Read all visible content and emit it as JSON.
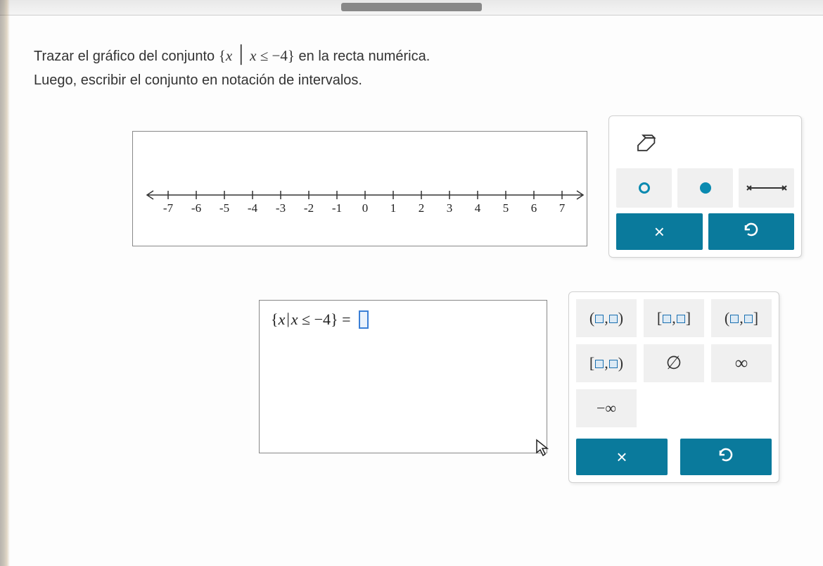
{
  "problem": {
    "line1_pre": "Trazar el gráfico del conjunto ",
    "set_open": "{",
    "set_var": "x",
    "set_bar": "│",
    "set_cond_var": "x",
    "set_cond_op": "≤",
    "set_cond_val": "−4",
    "set_close": "}",
    "line1_post": " en la recta numérica.",
    "line2": "Luego, escribir el conjunto en notación de intervalos."
  },
  "number_line": {
    "ticks": [
      "-7",
      "-6",
      "-5",
      "-4",
      "-3",
      "-2",
      "-1",
      "0",
      "1",
      "2",
      "3",
      "4",
      "5",
      "6",
      "7"
    ]
  },
  "tools_numberline": {
    "eraser": "eraser",
    "open_circle": "open-endpoint",
    "closed_circle": "closed-endpoint",
    "segment": "segment",
    "clear": "×",
    "undo": "↺"
  },
  "answer": {
    "lhs_open": "{",
    "lhs_var": "x",
    "lhs_bar": "|",
    "lhs_cond_var": "x",
    "lhs_cond_op": "≤",
    "lhs_cond_val": "−4",
    "lhs_close": "}",
    "eq": " = "
  },
  "tools_interval": {
    "open_open": {
      "l": "(",
      "r": ")"
    },
    "closed_closed": {
      "l": "[",
      "r": "]"
    },
    "open_closed": {
      "l": "(",
      "r": "]"
    },
    "closed_open": {
      "l": "[",
      "r": ")"
    },
    "empty": "∅",
    "inf": "∞",
    "ninf": "−∞",
    "clear": "×",
    "undo": "↺"
  },
  "chart_data": {
    "type": "line",
    "title": "",
    "xlabel": "",
    "ylabel": "",
    "x": [
      -7,
      -6,
      -5,
      -4,
      -3,
      -2,
      -1,
      0,
      1,
      2,
      3,
      4,
      5,
      6,
      7
    ],
    "series": [],
    "xlim": [
      -8,
      8
    ],
    "ylim": [
      0,
      0
    ]
  }
}
